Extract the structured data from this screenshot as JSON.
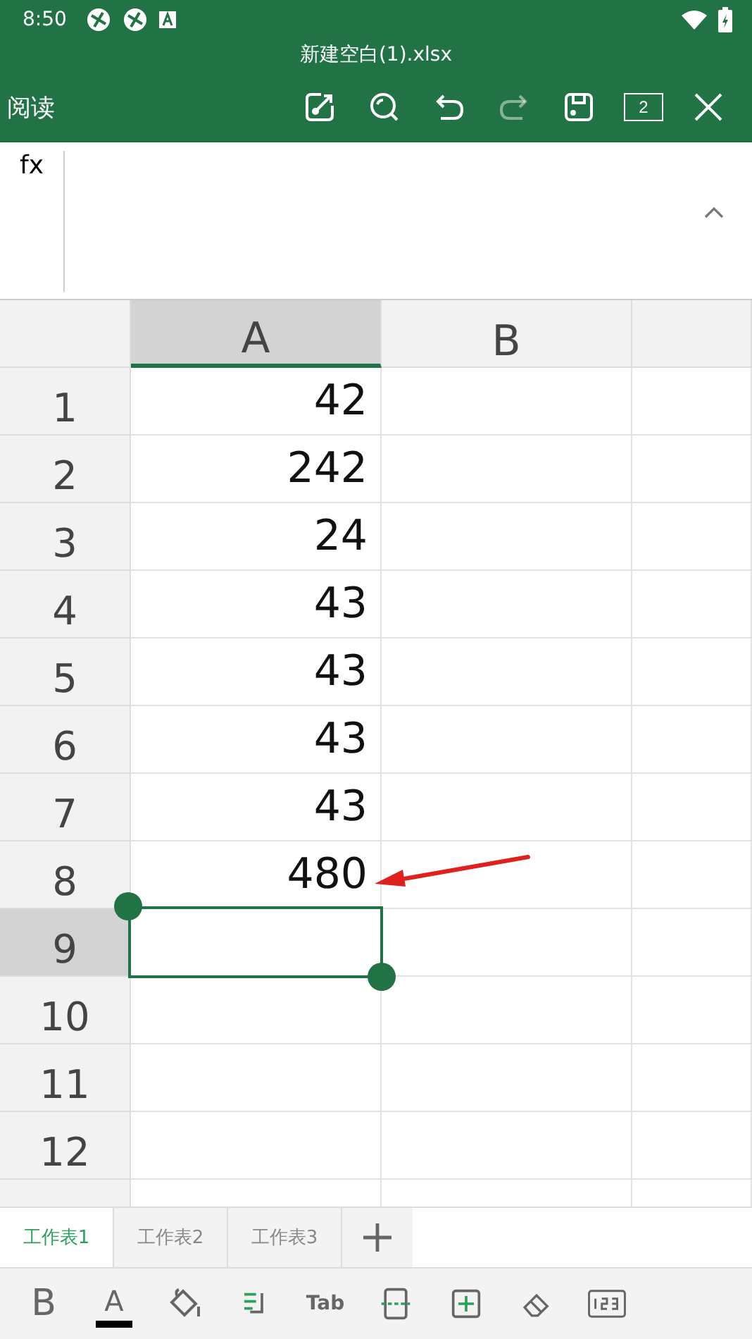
{
  "status_bar": {
    "time": "8:50"
  },
  "window": {
    "title": "新建空白(1).xlsx"
  },
  "toolbar": {
    "mode": "阅读",
    "actions": [
      {
        "disabled": false
      },
      {
        "disabled": false
      },
      {
        "disabled": false
      },
      {
        "disabled": true
      },
      {
        "disabled": false
      },
      {
        "text": "2",
        "disabled": false
      },
      {
        "disabled": false
      }
    ]
  },
  "formula_bar": {
    "label": "fx"
  },
  "columns": [
    {
      "label": "A",
      "selected": true
    },
    {
      "label": "B",
      "selected": false
    }
  ],
  "rows": [
    {
      "number": "1",
      "selected": false,
      "cells": [
        "42"
      ]
    },
    {
      "number": "2",
      "selected": false,
      "cells": [
        "242"
      ]
    },
    {
      "number": "3",
      "selected": false,
      "cells": [
        "24"
      ]
    },
    {
      "number": "4",
      "selected": false,
      "cells": [
        "43"
      ]
    },
    {
      "number": "5",
      "selected": false,
      "cells": [
        "43"
      ]
    },
    {
      "number": "6",
      "selected": false,
      "cells": [
        "43"
      ]
    },
    {
      "number": "7",
      "selected": false,
      "cells": [
        "43"
      ]
    },
    {
      "number": "8",
      "selected": false,
      "cells": [
        "480"
      ]
    },
    {
      "number": "9",
      "selected": true,
      "cells": []
    },
    {
      "number": "10",
      "selected": false,
      "cells": []
    },
    {
      "number": "11",
      "selected": false,
      "cells": []
    },
    {
      "number": "12",
      "selected": false,
      "cells": []
    }
  ],
  "sheet_tabs": [
    {
      "label": "工作表1",
      "selected": true
    },
    {
      "label": "工作表2",
      "selected": false
    },
    {
      "label": "工作表3",
      "selected": false
    }
  ],
  "bottom_toolbar": {
    "bold": "B",
    "font_color": "A",
    "tab_key": "Tab"
  }
}
